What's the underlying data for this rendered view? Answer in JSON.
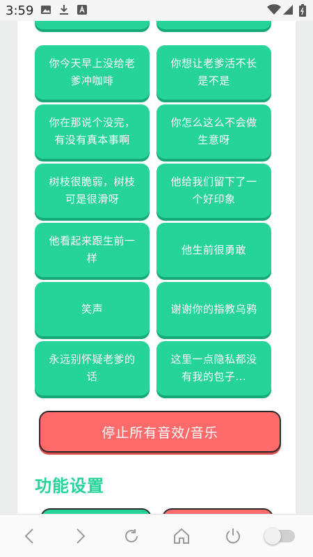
{
  "status_bar": {
    "time": "3:59",
    "left_icons": [
      "image-icon",
      "download-icon",
      "a-box-icon"
    ],
    "right_icons": [
      "wifi-icon",
      "cell-signal-icon",
      "battery-icon"
    ]
  },
  "sound_cards": [
    {
      "label": ""
    },
    {
      "label": ""
    },
    {
      "label": "你今天早上没给老爹冲咖啡"
    },
    {
      "label": "你想让老爹活不长是不是"
    },
    {
      "label": "你在那说个没完，有没有真本事啊"
    },
    {
      "label": "你怎么这么不会做生意呀"
    },
    {
      "label": "树枝很脆弱，树枝可是很滑呀"
    },
    {
      "label": "他给我们留下了一个好印象"
    },
    {
      "label": "他看起来跟生前一样"
    },
    {
      "label": "他生前很勇敢"
    },
    {
      "label": "笑声"
    },
    {
      "label": "谢谢你的指教乌鸦"
    },
    {
      "label": "永远别怀疑老爹的话"
    },
    {
      "label": "这里一点隐私都没有我的包子..."
    }
  ],
  "stop_button": {
    "label": "停止所有音效/音乐"
  },
  "settings": {
    "title": "功能设置"
  },
  "nav": {
    "icons": [
      "back-icon",
      "forward-icon",
      "reload-icon",
      "home-icon",
      "power-icon"
    ],
    "toggle_on": false
  },
  "colors": {
    "card": "#26d49a",
    "card_shadow": "#17a877",
    "stop": "#ff6b6b",
    "title": "#26d49a"
  }
}
